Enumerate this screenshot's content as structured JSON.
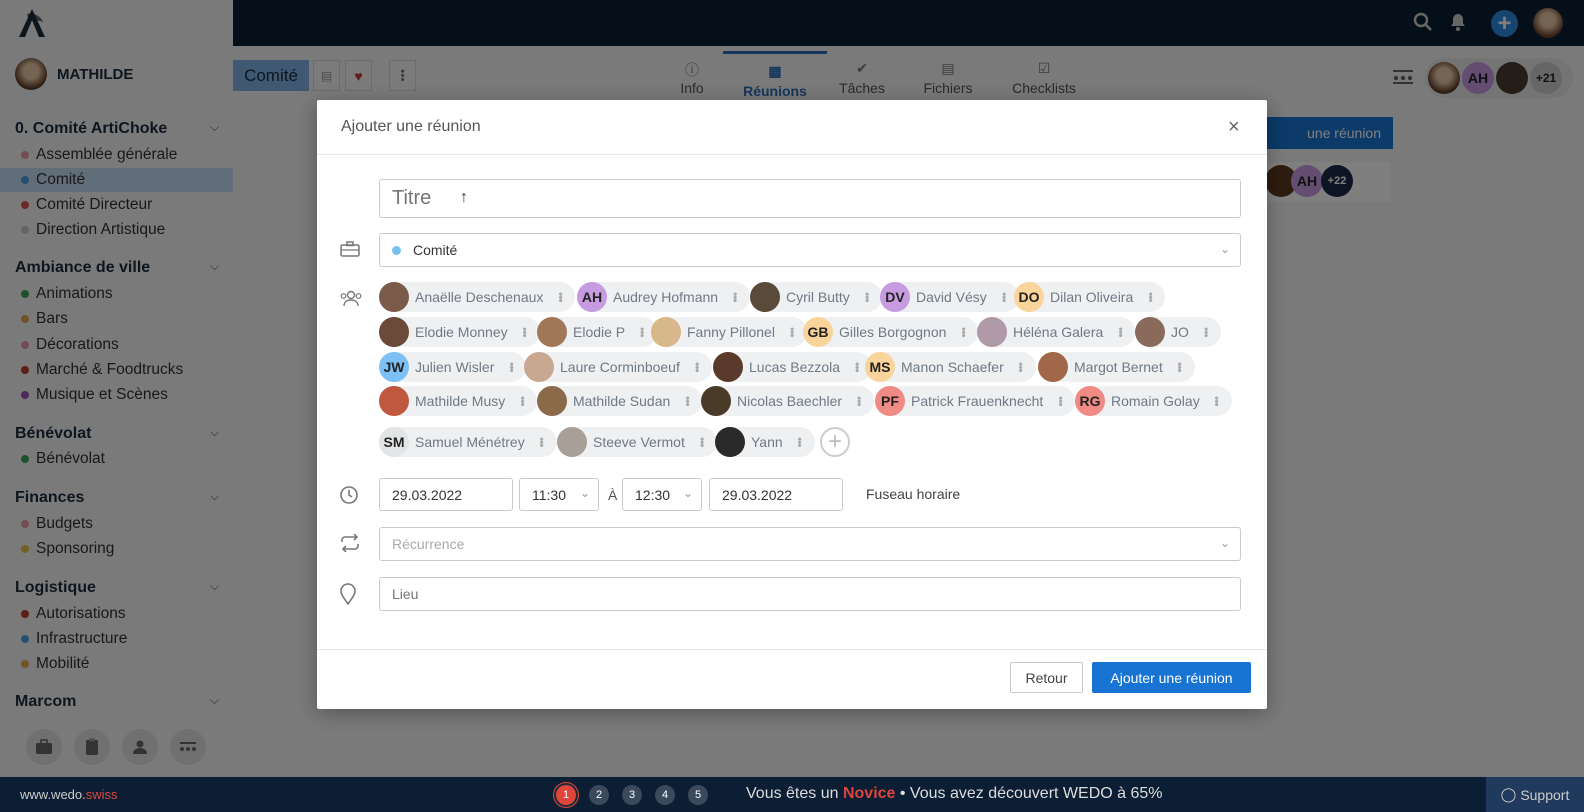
{
  "topbar": {
    "icons": [
      "search-icon",
      "bell-icon",
      "plus-icon",
      "user-avatar"
    ]
  },
  "user": {
    "name": "MATHILDE"
  },
  "sidebar": {
    "groups": [
      {
        "label": "0. Comité ArtiChoke",
        "items": [
          {
            "label": "Assemblée générale",
            "color": "#e69aa8"
          },
          {
            "label": "Comité",
            "color": "#4a9fe0",
            "active": true
          },
          {
            "label": "Comité Directeur",
            "color": "#d9534f"
          },
          {
            "label": "Direction Artistique",
            "color": "#c9c9c9"
          }
        ]
      },
      {
        "label": "Ambiance de ville",
        "items": [
          {
            "label": "Animations",
            "color": "#3aa655"
          },
          {
            "label": "Bars",
            "color": "#e0a94a"
          },
          {
            "label": "Décorations",
            "color": "#e69aa8"
          },
          {
            "label": "Marché & Foodtrucks",
            "color": "#c0392b"
          },
          {
            "label": "Musique et Scènes",
            "color": "#9b59b6"
          }
        ]
      },
      {
        "label": "Bénévolat",
        "items": [
          {
            "label": "Bénévolat",
            "color": "#3aa655"
          }
        ]
      },
      {
        "label": "Finances",
        "items": [
          {
            "label": "Budgets",
            "color": "#e69aa8"
          },
          {
            "label": "Sponsoring",
            "color": "#e0c04a"
          }
        ]
      },
      {
        "label": "Logistique",
        "items": [
          {
            "label": "Autorisations",
            "color": "#c0392b"
          },
          {
            "label": "Infrastructure",
            "color": "#4a9fe0"
          },
          {
            "label": "Mobilité",
            "color": "#e0a94a"
          }
        ]
      },
      {
        "label": "Marcom",
        "items": []
      }
    ]
  },
  "header": {
    "section_title": "Comité",
    "tabs": [
      {
        "label": "Info",
        "icon": "info-icon"
      },
      {
        "label": "Réunions",
        "icon": "calendar-icon",
        "active": true
      },
      {
        "label": "Tâches",
        "icon": "check-icon"
      },
      {
        "label": "Fichiers",
        "icon": "file-icon"
      },
      {
        "label": "Checklists",
        "icon": "checklist-icon"
      }
    ],
    "members_more": "+21"
  },
  "background": {
    "add_button_label": "une réunion",
    "members_more": "+22"
  },
  "modal": {
    "title": "Ajouter une réunion",
    "title_placeholder": "Titre",
    "workspace": "Comité",
    "participants": [
      {
        "name": "Anaëlle Deschenaux",
        "initials": "",
        "color": "#7a5a48"
      },
      {
        "name": "Audrey Hofmann",
        "initials": "AH",
        "color": "#c79be0"
      },
      {
        "name": "Cyril Butty",
        "initials": "",
        "color": "#5a4a3a"
      },
      {
        "name": "David Vésy",
        "initials": "DV",
        "color": "#c79be0"
      },
      {
        "name": "Dilan Oliveira",
        "initials": "DO",
        "color": "#f9d49b"
      },
      {
        "name": "Elodie Monney",
        "initials": "",
        "color": "#6a4a38"
      },
      {
        "name": "Elodie P",
        "initials": "",
        "color": "#a07858"
      },
      {
        "name": "Fanny Pillonel",
        "initials": "",
        "color": "#d8b88a"
      },
      {
        "name": "Gilles Borgognon",
        "initials": "GB",
        "color": "#f9d49b"
      },
      {
        "name": "Héléna Galera",
        "initials": "",
        "color": "#b09aa8"
      },
      {
        "name": "JO",
        "initials": "",
        "color": "#8a6a5a"
      },
      {
        "name": "Julien Wisler",
        "initials": "JW",
        "color": "#7cc0f5"
      },
      {
        "name": "Laure Corminboeuf",
        "initials": "",
        "color": "#c8a890"
      },
      {
        "name": "Lucas Bezzola",
        "initials": "",
        "color": "#5a3a2a"
      },
      {
        "name": "Manon Schaefer",
        "initials": "MS",
        "color": "#f9d49b"
      },
      {
        "name": "Margot Bernet",
        "initials": "",
        "color": "#a06848"
      },
      {
        "name": "Mathilde Musy",
        "initials": "",
        "color": "#c05840"
      },
      {
        "name": "Mathilde Sudan",
        "initials": "",
        "color": "#8a6a48"
      },
      {
        "name": "Nicolas Baechler",
        "initials": "",
        "color": "#4a3a28"
      },
      {
        "name": "Patrick Frauenknecht",
        "initials": "PF",
        "color": "#f08a84"
      },
      {
        "name": "Romain Golay",
        "initials": "RG",
        "color": "#f08a84"
      },
      {
        "name": "Samuel Ménétrey",
        "initials": "SM",
        "color": "#e2e4e6"
      },
      {
        "name": "Steeve Vermot",
        "initials": "",
        "color": "#a8a098"
      },
      {
        "name": "Yann",
        "initials": "",
        "color": "#2a2a2a"
      }
    ],
    "start_date": "29.03.2022",
    "start_time": "11:30",
    "to_label": "À",
    "end_time": "12:30",
    "end_date": "29.03.2022",
    "timezone_label": "Fuseau horaire",
    "recurrence_placeholder": "Récurrence",
    "location_placeholder": "Lieu",
    "back_label": "Retour",
    "submit_label": "Ajouter une réunion"
  },
  "footer": {
    "site_prefix": "www.wedo.",
    "site_suffix": "swiss",
    "levels": [
      "1",
      "2",
      "3",
      "4",
      "5"
    ],
    "progress_prefix": "Vous êtes un ",
    "progress_level": "Novice",
    "progress_suffix": " • Vous avez découvert WEDO à 65%",
    "support_label": "Support"
  }
}
